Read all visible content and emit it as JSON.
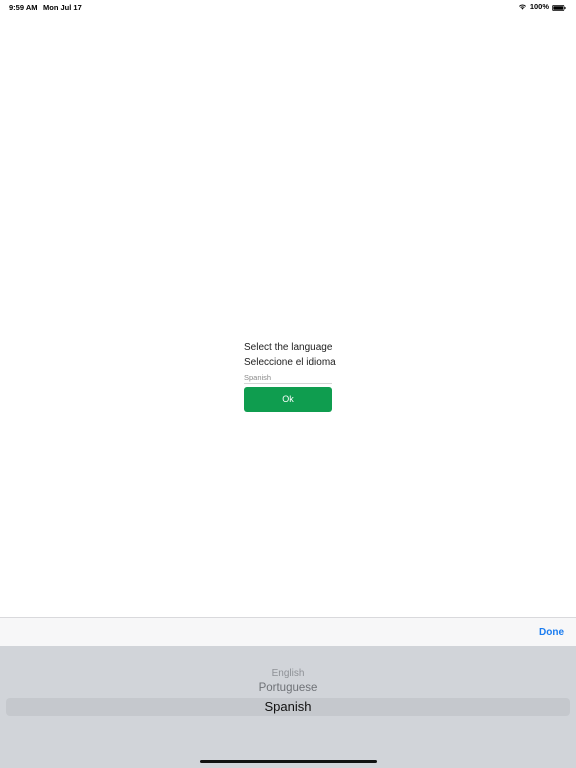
{
  "status_bar": {
    "time": "9:59 AM",
    "date": "Mon Jul 17",
    "battery": "100%"
  },
  "form": {
    "title_en": "Select the language",
    "title_es": "Seleccione el idioma",
    "language_value": "Spanish",
    "ok_label": "Ok",
    "ok_color": "#0f9d4f"
  },
  "picker_toolbar": {
    "done_label": "Done",
    "done_color": "#1a7cf0"
  },
  "picker": {
    "options": [
      "English",
      "Portuguese",
      "Spanish"
    ],
    "selected": "Spanish"
  }
}
